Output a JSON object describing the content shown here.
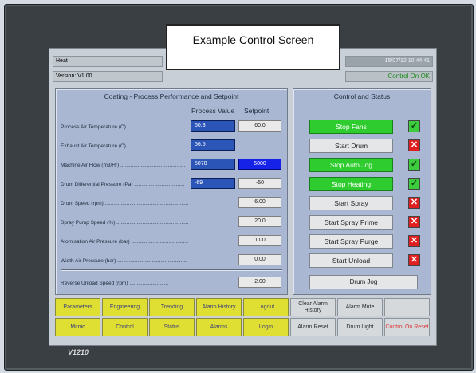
{
  "header": {
    "heat_label": "Heat",
    "version": "Version: V1.00",
    "datetime": "15/07/12 10:44:41",
    "status": "Control On OK"
  },
  "overlay_caption": "Example Control Screen",
  "process_panel": {
    "title": "Coating - Process Performance and Setpoint",
    "col_process_value": "Process Value",
    "col_setpoint": "Setpoint",
    "rows": [
      {
        "label": "Process Air Temperature (C) .........................................",
        "pv": "60.3",
        "sp": "60.0"
      },
      {
        "label": "Exhaust Air Temperature (C) .........................................",
        "pv": "56.5",
        "sp": null
      },
      {
        "label": "Machine Air Flow (m3/Hr) .............................................",
        "pv": "5070",
        "sp": "5000"
      },
      {
        "label": "Drum Differential Pressure (Pa) ...................................",
        "pv": "-69",
        "sp": "-50"
      },
      {
        "label": "Drum Speed (rpm) ..........................................................",
        "pv": null,
        "sp": "6.00"
      },
      {
        "label": "Spray Pump Speed (%) ...................................................",
        "pv": null,
        "sp": "20.0"
      },
      {
        "label": "Atomisation Air Pressure (bar) ..........................................",
        "pv": null,
        "sp": "1.00"
      },
      {
        "label": "Width Air Pressure (bar) ..................................................",
        "pv": null,
        "sp": "0.00"
      }
    ],
    "reverse_unload": {
      "label": "Reverse Unload Speed (rpm) ...........................",
      "sp": "2.00"
    }
  },
  "control_panel": {
    "title": "Control and Status",
    "buttons": [
      {
        "label": "Stop Fans",
        "active": true,
        "status": "ok"
      },
      {
        "label": "Start Drum",
        "active": false,
        "status": "off"
      },
      {
        "label": "Stop Auto Jog",
        "active": true,
        "status": "ok"
      },
      {
        "label": "Stop Heating",
        "active": true,
        "status": "ok"
      },
      {
        "label": "Start Spray",
        "active": false,
        "status": "off"
      },
      {
        "label": "Start Spray Prime",
        "active": false,
        "status": "off"
      },
      {
        "label": "Start Spray Purge",
        "active": false,
        "status": "off"
      },
      {
        "label": "Start Unload",
        "active": false,
        "status": "off"
      }
    ],
    "drum_jog": "Drum Jog"
  },
  "nav": {
    "row1": [
      "Parameters",
      "Engineering",
      "Trending",
      "Alarm History",
      "Logout",
      "Clear Alarm History",
      "Alarm Mute",
      ""
    ],
    "row2": [
      "Mimic",
      "Control",
      "Status",
      "Alarms",
      "Login",
      "Alarm Reset",
      "Drum Light",
      "Control On Reset"
    ]
  },
  "model_label": "V1210",
  "icons": {
    "ok": "check-icon",
    "off": "cross-icon"
  },
  "colors": {
    "active": "#2ecc2e",
    "highlight": "#1622e8",
    "nav_yellow": "#dede33",
    "alarm_red": "#e02020"
  }
}
